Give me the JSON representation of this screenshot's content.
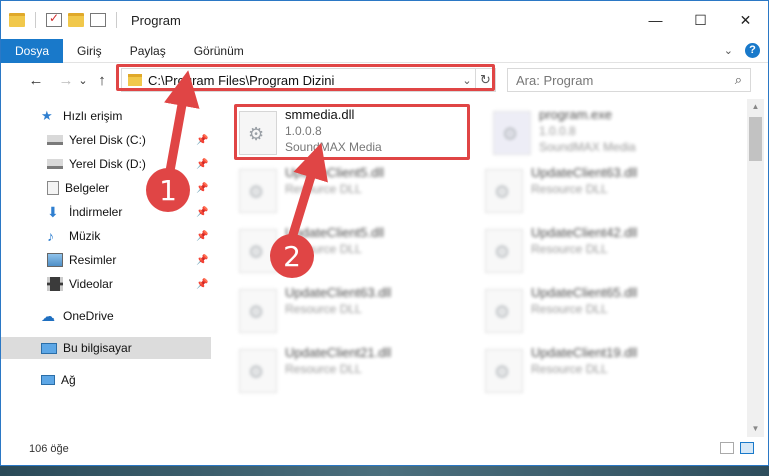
{
  "window": {
    "title": "Program",
    "controls": {
      "minimize": "—",
      "maximize": "☐",
      "close": "✕"
    }
  },
  "ribbon": {
    "tabs": [
      "Dosya",
      "Giriş",
      "Paylaş",
      "Görünüm"
    ],
    "expand_icon": "chevron-down-icon",
    "help_label": "?"
  },
  "address": {
    "path": "C:\\Program Files\\Program Dizini",
    "dropdown_glyph": "⌄",
    "refresh_glyph": "↻"
  },
  "search": {
    "placeholder": "Ara: Program",
    "icon_glyph": "⌕"
  },
  "nav": {
    "back": "←",
    "forward": "→",
    "recent": "⌄",
    "up": "↑"
  },
  "sidebar": {
    "items": [
      {
        "label": "Hızlı erişim",
        "icon": "star-icon",
        "pinned": false
      },
      {
        "label": "Yerel Disk (C:)",
        "icon": "drive-icon",
        "pinned": true
      },
      {
        "label": "Yerel Disk (D:)",
        "icon": "drive-icon",
        "pinned": true
      },
      {
        "label": "Belgeler",
        "icon": "document-icon",
        "pinned": true
      },
      {
        "label": "İndirmeler",
        "icon": "download-icon",
        "pinned": true
      },
      {
        "label": "Müzik",
        "icon": "music-icon",
        "pinned": true
      },
      {
        "label": "Resimler",
        "icon": "picture-icon",
        "pinned": true
      },
      {
        "label": "Videolar",
        "icon": "video-icon",
        "pinned": true
      },
      {
        "label": "OneDrive",
        "icon": "cloud-icon",
        "pinned": false
      },
      {
        "label": "Bu bilgisayar",
        "icon": "computer-icon",
        "pinned": false,
        "selected": true
      },
      {
        "label": "Ağ",
        "icon": "network-icon",
        "pinned": false
      }
    ]
  },
  "files": [
    {
      "name": "smmedia.dll",
      "line2": "1.0.0.8",
      "line3": "SoundMAX Media",
      "highlighted": true
    },
    {
      "name": "program.exe",
      "line2": "1.0.0.8",
      "line3": "SoundMAX Media"
    },
    {
      "name": "UpdateClient5.dll",
      "line2": "Resource DLL"
    },
    {
      "name": "UpdateClient63.dll",
      "line2": "Resource DLL"
    },
    {
      "name": "UpdateClient5.dll",
      "line2": "Resource DLL"
    },
    {
      "name": "UpdateClient42.dll",
      "line2": "Resource DLL"
    },
    {
      "name": "UpdateClient63.dll",
      "line2": "Resource DLL"
    },
    {
      "name": "UpdateClient65.dll",
      "line2": "Resource DLL"
    },
    {
      "name": "UpdateClient21.dll",
      "line2": "Resource DLL"
    },
    {
      "name": "UpdateClient19.dll",
      "line2": "Resource DLL"
    }
  ],
  "status": {
    "item_count": "106 öğe"
  },
  "annotations": {
    "step1": "1",
    "step2": "2",
    "color": "#e04545"
  }
}
